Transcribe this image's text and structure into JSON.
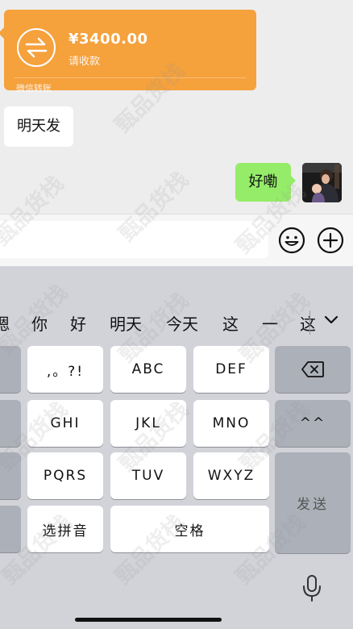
{
  "chat": {
    "transfer": {
      "amount": "¥3400.00",
      "subtitle": "请收款",
      "footer": "微信转账",
      "icon": "transfer-arrows-icon",
      "color": "#f5a13c"
    },
    "incoming_message": "明天发",
    "outgoing_message": "好嘞",
    "outgoing_bubble_color": "#95ec69"
  },
  "input_bar": {
    "emoji_icon": "smiley-face-icon",
    "more_icon": "plus-circle-icon"
  },
  "keyboard": {
    "candidates": [
      "嗯",
      "你",
      "好",
      "明天",
      "今天",
      "这",
      "一",
      "这"
    ],
    "expand_icon": "chevron-down-icon",
    "keys": {
      "punct": ",。?!",
      "abc": "ABC",
      "def": "DEF",
      "ghi": "GHI",
      "jkl": "JKL",
      "mno": "MNO",
      "pqrs": "PQRS",
      "tuv": "TUV",
      "wxyz": "WXYZ",
      "pinyin": "选拼音",
      "space": "空格",
      "emoticon": "^^",
      "send": "发送"
    },
    "backspace_icon": "backspace-icon",
    "mic_icon": "microphone-icon"
  },
  "watermark": "甄品货栈"
}
